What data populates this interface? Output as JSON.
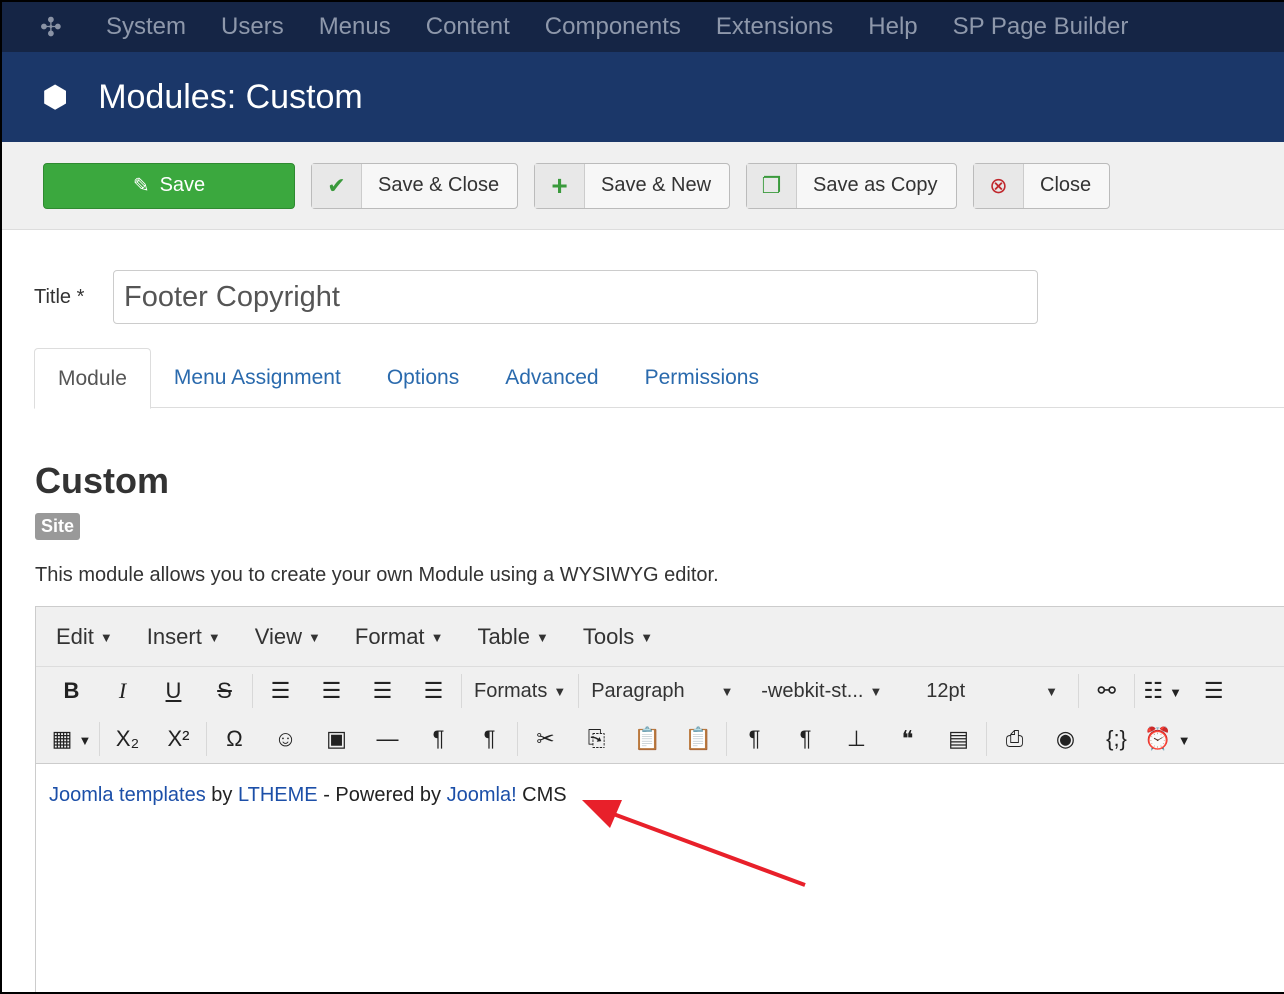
{
  "topnav": {
    "items": [
      "System",
      "Users",
      "Menus",
      "Content",
      "Components",
      "Extensions",
      "Help",
      "SP Page Builder"
    ]
  },
  "header": {
    "title": "Modules: Custom"
  },
  "toolbar": {
    "save": "Save",
    "save_close": "Save & Close",
    "save_new": "Save & New",
    "save_copy": "Save as Copy",
    "close": "Close"
  },
  "form": {
    "title_label": "Title *",
    "title_value": "Footer Copyright"
  },
  "tabs": [
    "Module",
    "Menu Assignment",
    "Options",
    "Advanced",
    "Permissions"
  ],
  "module": {
    "heading": "Custom",
    "badge": "Site",
    "description": "This module allows you to create your own Module using a WYSIWYG editor."
  },
  "editor": {
    "menus": [
      "Edit",
      "Insert",
      "View",
      "Format",
      "Table",
      "Tools"
    ],
    "formats": "Formats",
    "block": "Paragraph",
    "font": "-webkit-st...",
    "size": "12pt",
    "content": {
      "link1": "Joomla templates",
      "t1": " by ",
      "link2": "LTHEME",
      "t2": " - Powered by ",
      "link3": "Joomla!",
      "t3": " CMS"
    }
  },
  "colors": {
    "save": "#3ba83e",
    "nav": "#152545",
    "header": "#1b3769",
    "link": "#1c4fa8",
    "arrow": "#e8202a"
  }
}
